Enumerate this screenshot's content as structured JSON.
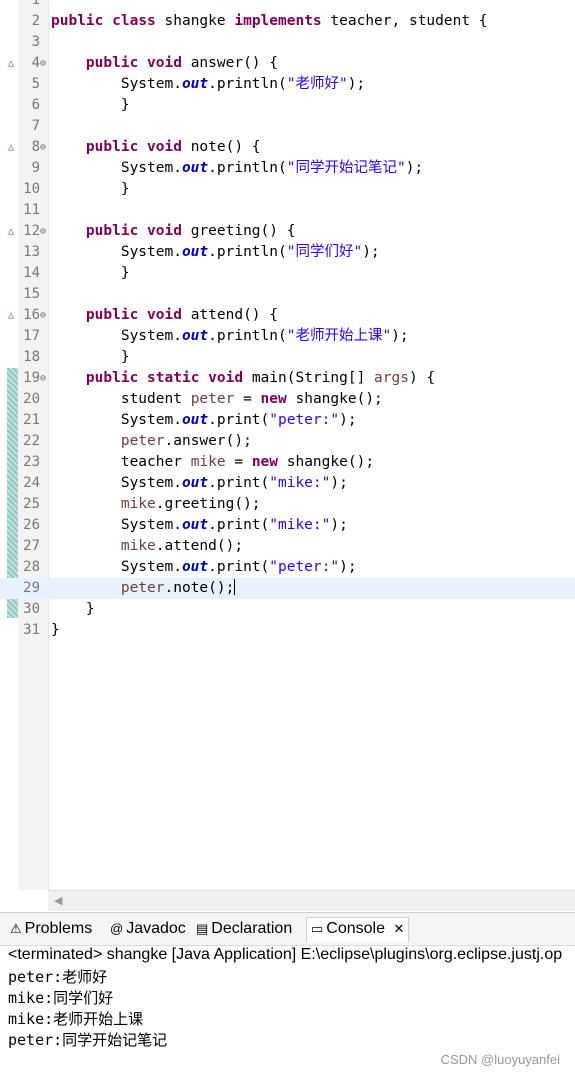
{
  "editor": {
    "lines": [
      {
        "n": "1",
        "tokens": []
      },
      {
        "n": "2",
        "tokens": [
          {
            "t": "public",
            "c": "kw"
          },
          {
            "t": " "
          },
          {
            "t": "class",
            "c": "kw"
          },
          {
            "t": " shangke "
          },
          {
            "t": "implements",
            "c": "kw"
          },
          {
            "t": " teacher, student {"
          }
        ]
      },
      {
        "n": "3",
        "tokens": []
      },
      {
        "n": "4",
        "ovr": true,
        "fold": true,
        "tokens": [
          {
            "t": "    "
          },
          {
            "t": "public",
            "c": "kw"
          },
          {
            "t": " "
          },
          {
            "t": "void",
            "c": "kw"
          },
          {
            "t": " answer() {"
          }
        ]
      },
      {
        "n": "5",
        "tokens": [
          {
            "t": "        System."
          },
          {
            "t": "out",
            "c": "fld"
          },
          {
            "t": ".println("
          },
          {
            "t": "\"老师好\"",
            "c": "st"
          },
          {
            "t": ");"
          }
        ]
      },
      {
        "n": "6",
        "tokens": [
          {
            "t": "        }"
          }
        ]
      },
      {
        "n": "7",
        "tokens": []
      },
      {
        "n": "8",
        "ovr": true,
        "fold": true,
        "tokens": [
          {
            "t": "    "
          },
          {
            "t": "public",
            "c": "kw"
          },
          {
            "t": " "
          },
          {
            "t": "void",
            "c": "kw"
          },
          {
            "t": " note() {"
          }
        ]
      },
      {
        "n": "9",
        "tokens": [
          {
            "t": "        System."
          },
          {
            "t": "out",
            "c": "fld"
          },
          {
            "t": ".println("
          },
          {
            "t": "\"同学开始记笔记\"",
            "c": "st"
          },
          {
            "t": ");"
          }
        ]
      },
      {
        "n": "10",
        "tokens": [
          {
            "t": "        }"
          }
        ]
      },
      {
        "n": "11",
        "tokens": []
      },
      {
        "n": "12",
        "ovr": true,
        "fold": true,
        "tokens": [
          {
            "t": "    "
          },
          {
            "t": "public",
            "c": "kw"
          },
          {
            "t": " "
          },
          {
            "t": "void",
            "c": "kw"
          },
          {
            "t": " greeting() {"
          }
        ]
      },
      {
        "n": "13",
        "tokens": [
          {
            "t": "        System."
          },
          {
            "t": "out",
            "c": "fld"
          },
          {
            "t": ".println("
          },
          {
            "t": "\"同学们好\"",
            "c": "st"
          },
          {
            "t": ");"
          }
        ]
      },
      {
        "n": "14",
        "tokens": [
          {
            "t": "        }"
          }
        ]
      },
      {
        "n": "15",
        "tokens": []
      },
      {
        "n": "16",
        "ovr": true,
        "fold": true,
        "tokens": [
          {
            "t": "    "
          },
          {
            "t": "public",
            "c": "kw"
          },
          {
            "t": " "
          },
          {
            "t": "void",
            "c": "kw"
          },
          {
            "t": " attend() {"
          }
        ]
      },
      {
        "n": "17",
        "tokens": [
          {
            "t": "        System."
          },
          {
            "t": "out",
            "c": "fld"
          },
          {
            "t": ".println("
          },
          {
            "t": "\"老师开始上课\"",
            "c": "st"
          },
          {
            "t": ");"
          }
        ]
      },
      {
        "n": "18",
        "tokens": [
          {
            "t": "        }"
          }
        ]
      },
      {
        "n": "19",
        "fold": true,
        "tokens": [
          {
            "t": "    "
          },
          {
            "t": "public",
            "c": "kw"
          },
          {
            "t": " "
          },
          {
            "t": "static",
            "c": "kw"
          },
          {
            "t": " "
          },
          {
            "t": "void",
            "c": "kw"
          },
          {
            "t": " main(String[] "
          },
          {
            "t": "args",
            "c": "var"
          },
          {
            "t": ") {"
          }
        ]
      },
      {
        "n": "20",
        "tokens": [
          {
            "t": "        student "
          },
          {
            "t": "peter",
            "c": "var"
          },
          {
            "t": " = "
          },
          {
            "t": "new",
            "c": "kw"
          },
          {
            "t": " shangke();"
          }
        ]
      },
      {
        "n": "21",
        "tokens": [
          {
            "t": "        System."
          },
          {
            "t": "out",
            "c": "fld"
          },
          {
            "t": ".print("
          },
          {
            "t": "\"peter:\"",
            "c": "st"
          },
          {
            "t": ");"
          }
        ]
      },
      {
        "n": "22",
        "tokens": [
          {
            "t": "        "
          },
          {
            "t": "peter",
            "c": "var"
          },
          {
            "t": ".answer();"
          }
        ]
      },
      {
        "n": "23",
        "tokens": [
          {
            "t": "        teacher "
          },
          {
            "t": "mike",
            "c": "var"
          },
          {
            "t": " = "
          },
          {
            "t": "new",
            "c": "kw"
          },
          {
            "t": " shangke();"
          }
        ]
      },
      {
        "n": "24",
        "tokens": [
          {
            "t": "        System."
          },
          {
            "t": "out",
            "c": "fld"
          },
          {
            "t": ".print("
          },
          {
            "t": "\"mike:\"",
            "c": "st"
          },
          {
            "t": ");"
          }
        ]
      },
      {
        "n": "25",
        "tokens": [
          {
            "t": "        "
          },
          {
            "t": "mike",
            "c": "var"
          },
          {
            "t": ".greeting();"
          }
        ]
      },
      {
        "n": "26",
        "tokens": [
          {
            "t": "        System."
          },
          {
            "t": "out",
            "c": "fld"
          },
          {
            "t": ".print("
          },
          {
            "t": "\"mike:\"",
            "c": "st"
          },
          {
            "t": ");"
          }
        ]
      },
      {
        "n": "27",
        "tokens": [
          {
            "t": "        "
          },
          {
            "t": "mike",
            "c": "var"
          },
          {
            "t": ".attend();"
          }
        ]
      },
      {
        "n": "28",
        "tokens": [
          {
            "t": "        System."
          },
          {
            "t": "out",
            "c": "fld"
          },
          {
            "t": ".print("
          },
          {
            "t": "\"peter:\"",
            "c": "st"
          },
          {
            "t": ");"
          }
        ]
      },
      {
        "n": "29",
        "current": true,
        "tokens": [
          {
            "t": "        "
          },
          {
            "t": "peter",
            "c": "var"
          },
          {
            "t": ".note();"
          }
        ]
      },
      {
        "n": "30",
        "tokens": [
          {
            "t": "    }"
          }
        ]
      },
      {
        "n": "31",
        "tokens": [
          {
            "t": "}"
          }
        ]
      }
    ]
  },
  "console": {
    "tabs": [
      {
        "label": "Problems",
        "icon": "problems-icon",
        "glyph": "⚠"
      },
      {
        "label": "Javadoc",
        "icon": "javadoc-icon",
        "glyph": "@"
      },
      {
        "label": "Declaration",
        "icon": "declaration-icon",
        "glyph": "▤"
      },
      {
        "label": "Console",
        "icon": "console-icon",
        "glyph": "▭",
        "active": true
      }
    ],
    "close_glyph": "✕",
    "status": "<terminated> shangke [Java Application] E:\\eclipse\\plugins\\org.eclipse.justj.op",
    "output": [
      "peter:老师好",
      "mike:同学们好",
      "mike:老师开始上课",
      "peter:同学开始记笔记"
    ]
  },
  "watermark": "CSDN @luoyuyanfei"
}
